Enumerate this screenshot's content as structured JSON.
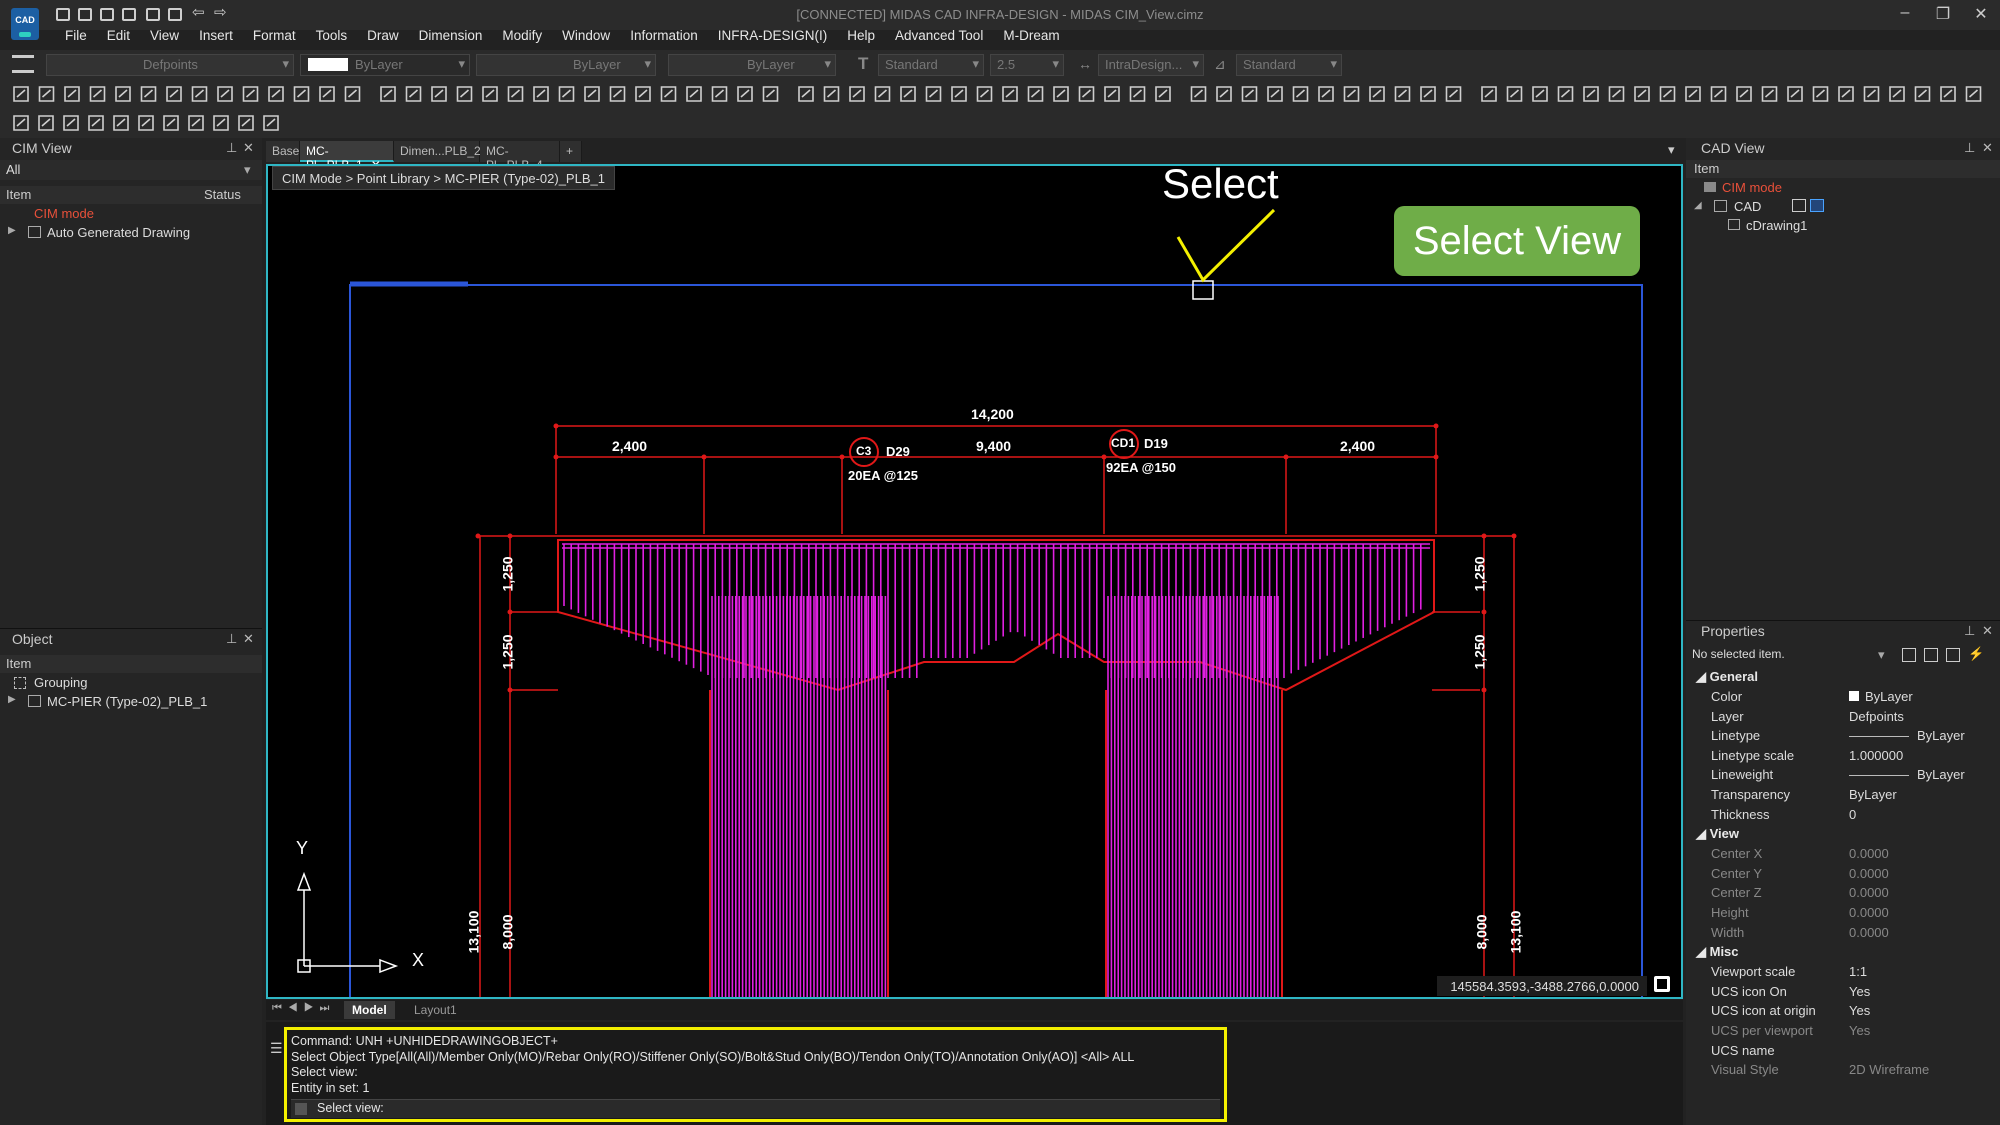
{
  "app": {
    "title": "[CONNECTED] MIDAS CAD INFRA-DESIGN - MIDAS CIM_View.cimz",
    "logo": "CAD"
  },
  "menu": [
    "File",
    "Edit",
    "View",
    "Insert",
    "Format",
    "Tools",
    "Draw",
    "Dimension",
    "Modify",
    "Window",
    "Information",
    "INFRA-DESIGN(I)",
    "Help",
    "Advanced Tool",
    "M-Dream"
  ],
  "toolbar": {
    "layer": "Defpoints",
    "color": "ByLayer",
    "linetype": "ByLayer",
    "lineweight": "ByLayer",
    "textstyle": "Standard",
    "textsize": "2.5",
    "dimstyle": "IntraDesign...",
    "tablestyle": "Standard"
  },
  "cim_view": {
    "title": "CIM View",
    "filter": "All",
    "col_item": "Item",
    "col_status": "Status",
    "items": [
      "CIM mode",
      "Auto Generated Drawing"
    ]
  },
  "object_panel": {
    "title": "Object",
    "col_item": "Item",
    "items": [
      "Grouping",
      "MC-PIER (Type-02)_PLB_1"
    ]
  },
  "tabs": [
    "Base",
    "MC-Pl...PLB_1",
    "Dimen...PLB_2",
    "MC-Pl...PLB_4",
    "+"
  ],
  "breadcrumb": "CIM Mode > Point Library > MC-PIER (Type-02)_PLB_1",
  "annotations": {
    "select": "Select",
    "select_view": "Select View"
  },
  "drawing": {
    "dims": [
      "14,200",
      "2,400",
      "9,400",
      "2,400",
      "1,250",
      "1,250",
      "1,250",
      "1,250",
      "13,100",
      "8,000",
      "8,000",
      "13,100"
    ],
    "c3": "C3",
    "c3_bar": "D29",
    "c3_qty": "20EA @125",
    "cd1": "CD1",
    "cd1_bar": "D19",
    "cd1_qty": "92EA @150",
    "axis_y": "Y",
    "axis_x": "X"
  },
  "coords": "145584.3593,-3488.2766,0.0000",
  "layout_tabs": [
    "Model",
    "Layout1"
  ],
  "command": {
    "lines": [
      "Command:  UNH +UNHIDEDRAWINGOBJECT+",
      "Select Object Type[All(All)/Member Only(MO)/Rebar Only(RO)/Stiffener Only(SO)/Bolt&Stud Only(BO)/Tendon Only(TO)/Annotation Only(AO)] <All> ALL",
      "Select view:",
      "Entity in set: 1"
    ],
    "prompt": "Select view:"
  },
  "cad_view": {
    "title": "CAD View",
    "col_item": "Item",
    "items": [
      "CIM mode",
      "CAD",
      "cDrawing1"
    ]
  },
  "properties": {
    "title": "Properties",
    "selection": "No selected item.",
    "sections": [
      {
        "name": "General",
        "rows": [
          [
            "Color",
            "ByLayer"
          ],
          [
            "Layer",
            "Defpoints"
          ],
          [
            "Linetype",
            "ByLayer"
          ],
          [
            "Linetype scale",
            "1.000000"
          ],
          [
            "Lineweight",
            "ByLayer"
          ],
          [
            "Transparency",
            "ByLayer"
          ],
          [
            "Thickness",
            "0"
          ]
        ]
      },
      {
        "name": "View",
        "rows": [
          [
            "Center X",
            "0.0000"
          ],
          [
            "Center Y",
            "0.0000"
          ],
          [
            "Center Z",
            "0.0000"
          ],
          [
            "Height",
            "0.0000"
          ],
          [
            "Width",
            "0.0000"
          ]
        ]
      },
      {
        "name": "Misc",
        "rows": [
          [
            "Viewport scale",
            "1:1"
          ],
          [
            "UCS icon On",
            "Yes"
          ],
          [
            "UCS icon at origin",
            "Yes"
          ],
          [
            "UCS per viewport",
            "Yes"
          ],
          [
            "UCS name",
            ""
          ],
          [
            "Visual Style",
            "2D Wireframe"
          ]
        ]
      }
    ]
  },
  "colors": {
    "accent": "#2fb6c4",
    "rebar": "#e020e0",
    "dim": "#e01818",
    "highlight": "#f4f000",
    "select_view_bg": "#6fad48"
  }
}
